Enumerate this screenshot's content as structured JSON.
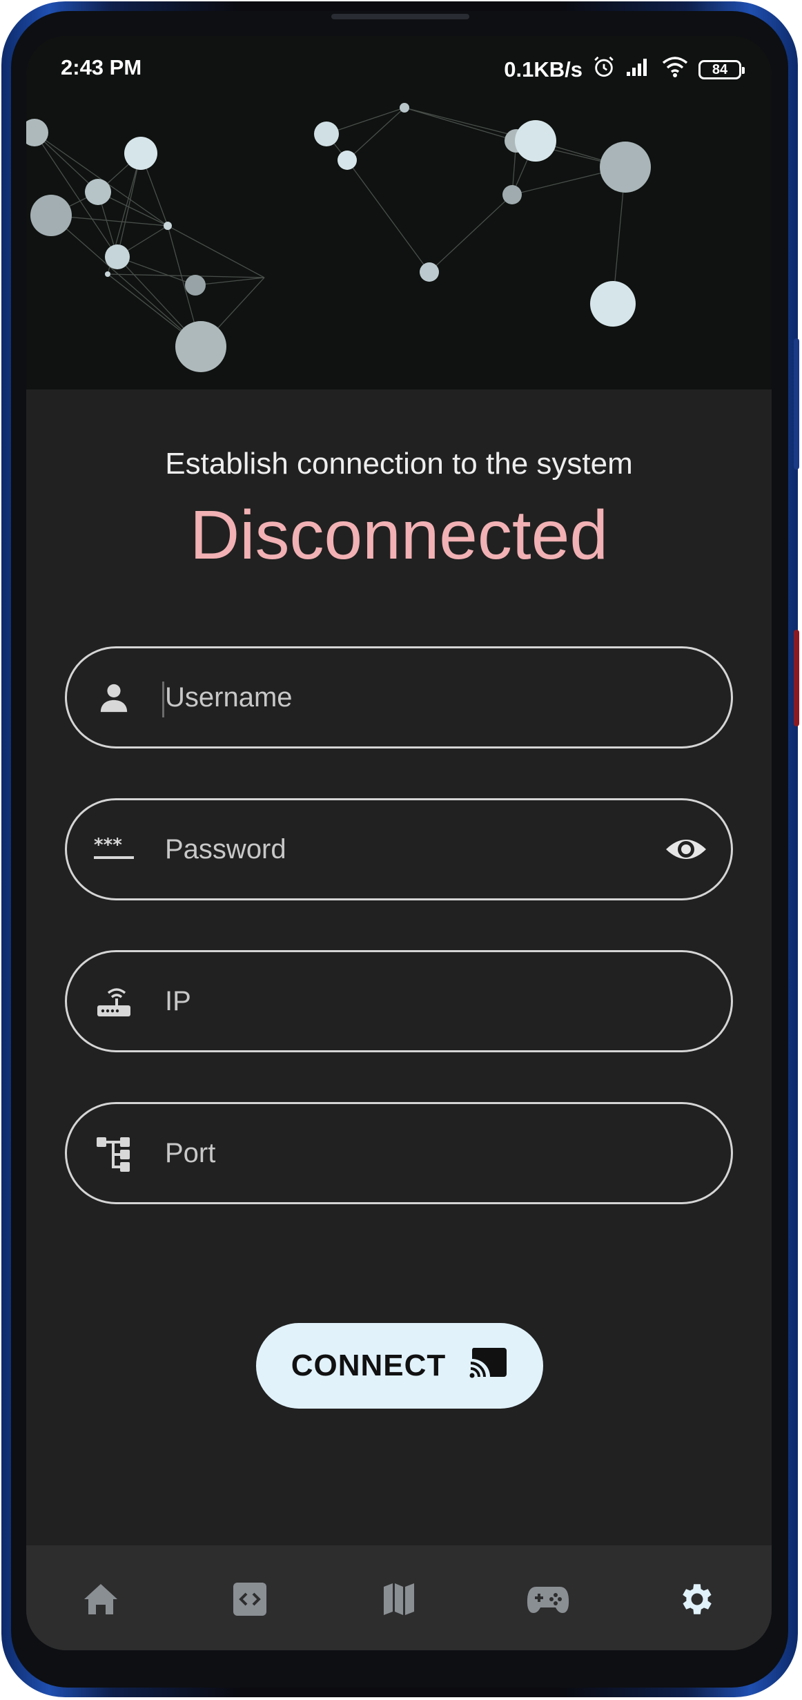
{
  "status_bar": {
    "time": "2:43 PM",
    "net_speed": "0.1KB/s",
    "battery": "84",
    "icons": [
      "alarm-icon",
      "signal-icon",
      "wifi-icon",
      "battery-icon"
    ]
  },
  "header": {
    "subtitle": "Establish connection to the system",
    "status": "Disconnected",
    "status_color": "#f2b1b4"
  },
  "form": {
    "username": {
      "placeholder": "Username",
      "value": "",
      "icon": "person-icon"
    },
    "password": {
      "placeholder": "Password",
      "value": "",
      "icon": "password-dots-icon",
      "toggle_icon": "eye-icon"
    },
    "ip": {
      "placeholder": "IP",
      "value": "",
      "icon": "router-icon"
    },
    "port": {
      "placeholder": "Port",
      "value": "",
      "icon": "network-tree-icon"
    }
  },
  "connect_button": {
    "label": "CONNECT",
    "icon": "cast-icon",
    "bg": "#e1f2fb"
  },
  "bottom_nav": {
    "items": [
      {
        "name": "home",
        "icon": "home-icon",
        "active": false
      },
      {
        "name": "code",
        "icon": "code-icon",
        "active": false
      },
      {
        "name": "map",
        "icon": "map-icon",
        "active": false
      },
      {
        "name": "gamepad",
        "icon": "gamepad-icon",
        "active": false
      },
      {
        "name": "settings",
        "icon": "gear-icon",
        "active": true
      }
    ]
  },
  "colors": {
    "background": "#212121",
    "hero_bg": "#0f1210",
    "nav_bg": "#2d2d2d",
    "field_border": "#d5d5d5"
  }
}
